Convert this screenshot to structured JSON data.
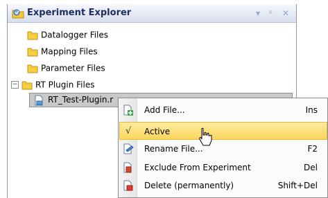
{
  "panel": {
    "title": "Experiment Explorer",
    "buttons": {
      "dropdown": "▾",
      "pin": "ᵖ",
      "close": "✕"
    }
  },
  "tree": {
    "items": [
      {
        "label": "Datalogger Files"
      },
      {
        "label": "Mapping Files"
      },
      {
        "label": "Parameter Files"
      },
      {
        "label": "RT Plugin Files",
        "expander": "−"
      },
      {
        "label": "RT_Test-Plugin.r"
      }
    ]
  },
  "context_menu": {
    "items": [
      {
        "label": "Add File...",
        "shortcut": "Ins"
      },
      {
        "label": "Active",
        "shortcut": "",
        "checked": "√"
      },
      {
        "label": "Rename File...",
        "shortcut": "F2"
      },
      {
        "label": "Exclude From Experiment",
        "shortcut": "Del"
      },
      {
        "label": "Delete (permanently)",
        "shortcut": "Shift+Del"
      }
    ]
  },
  "colors": {
    "highlight": "#fbd75e",
    "folder": "#f0c020",
    "title_text": "#1d2e63"
  },
  "icons": [
    "explorer-icon",
    "folder-icon",
    "plugin-file-icon",
    "add-file-icon",
    "rename-icon",
    "exclude-icon",
    "delete-icon",
    "mouse-cursor-icon"
  ]
}
